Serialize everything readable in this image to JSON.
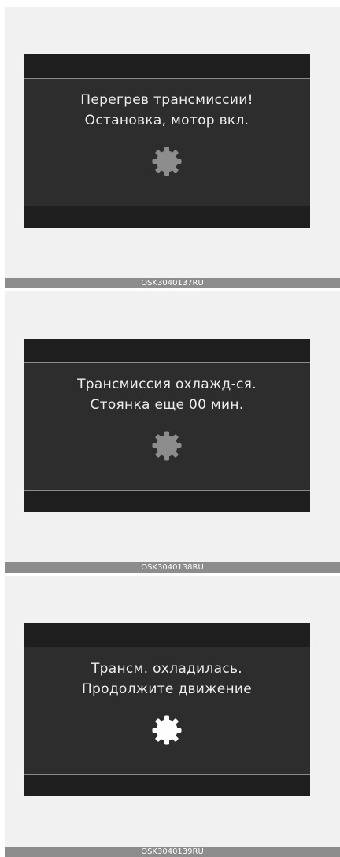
{
  "panels": [
    {
      "line1": "Перегрев трансмиссии!",
      "line2": "Остановка, мотор вкл.",
      "icon": "transmission-temperature-icon",
      "icon_state": "dim",
      "caption": "OSK3040137RU"
    },
    {
      "line1": "Трансмиссия охлажд-ся.",
      "line2": "Стоянка еще 00 мин.",
      "icon": "transmission-temperature-icon",
      "icon_state": "dim",
      "caption": "OSK3040138RU"
    },
    {
      "line1": "Трансм. охладилась.",
      "line2": "Продолжите движение",
      "icon": "transmission-temperature-icon",
      "icon_state": "bright",
      "caption": "OSK3040139RU"
    }
  ],
  "colors": {
    "screen_bg": "#2d2d2d",
    "bar_bg": "#1e1e1e",
    "text": "#ededed",
    "icon_dim": "#8d8d8d",
    "icon_bright": "#ffffff",
    "caption_bg": "#8c8c8c"
  }
}
